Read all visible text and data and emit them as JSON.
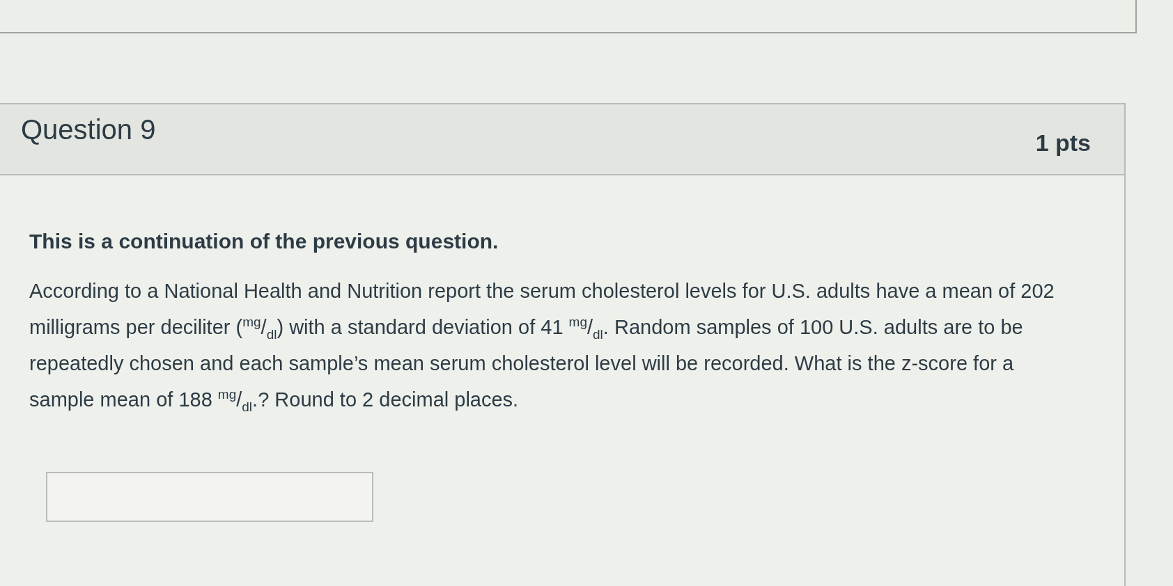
{
  "question": {
    "title": "Question 9",
    "points": "1 pts",
    "intro": "This is a continuation of the previous question.",
    "text": "According to a National Health and Nutrition report the serum cholesterol levels for U.S. adults have a mean of 202 milligrams per deciliter ($^{mg}$/$_{dl}$) with a standard deviation of 41 $^{mg}$/$_{dl}$. Random samples of 100 U.S. adults are to be repeatedly chosen and each sample’s mean serum cholesterol level will be recorded. What is the z-score for a sample mean of 188 $^{mg}$/$_{dl}$.? Round to 2 decimal places."
  }
}
